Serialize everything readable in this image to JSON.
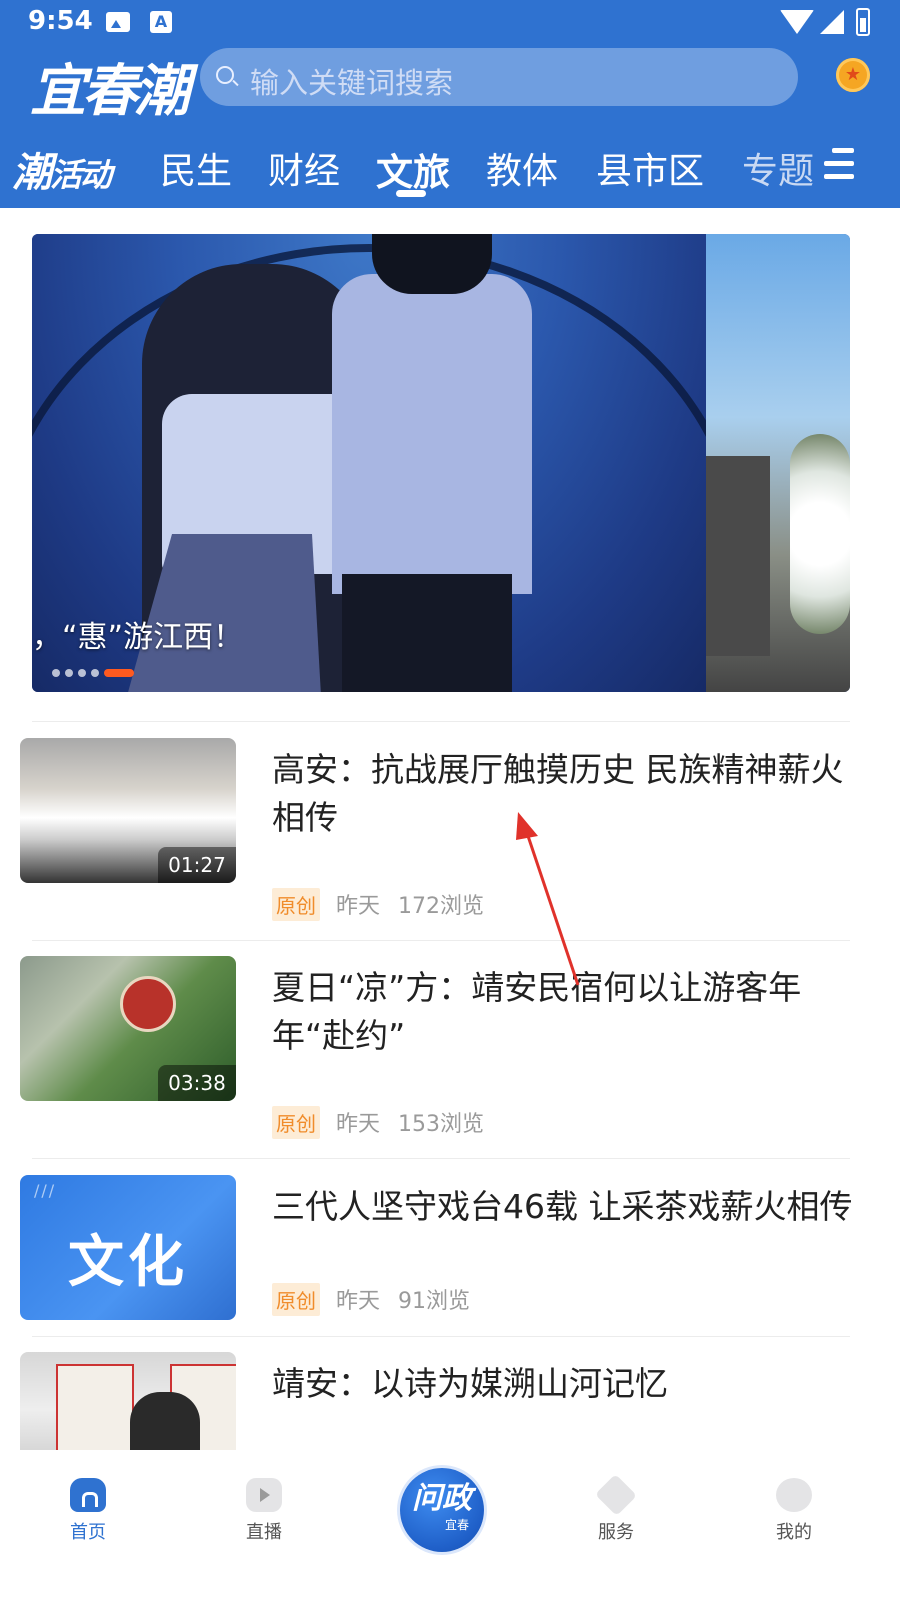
{
  "status_bar": {
    "time": "9:54",
    "notification_letter": "A"
  },
  "header": {
    "logo_text": "宜春潮",
    "search_placeholder": "输入关键词搜索"
  },
  "channel_tabs": {
    "activity_big": "潮",
    "activity_small": "活动",
    "items": [
      "民生",
      "财经",
      "文旅",
      "教体",
      "县市区",
      "专题"
    ],
    "active_index": 2
  },
  "banner": {
    "caption": "，“惠”游江西！",
    "slide_count": 5,
    "active_slide": 4
  },
  "news": [
    {
      "title": "高安：抗战展厅触摸历史 民族精神薪火相传",
      "duration": "01:27",
      "tag": "原创",
      "time": "昨天",
      "views": "172浏览"
    },
    {
      "title": "夏日“凉”方：靖安民宿何以让游客年年“赴约”",
      "duration": "03:38",
      "tag": "原创",
      "time": "昨天",
      "views": "153浏览"
    },
    {
      "title": "三代人坚守戏台46载  让采茶戏薪火相传",
      "thumb_text": "文化",
      "tag": "原创",
      "time": "昨天",
      "views": "91浏览"
    },
    {
      "title": "靖安：以诗为媒溯山河记忆"
    }
  ],
  "bottom_nav": {
    "home": "首页",
    "live": "直播",
    "center_main": "问政",
    "center_sub": "宜春",
    "service": "服务",
    "mine": "我的"
  },
  "colors": {
    "brand_blue": "#2f72d0",
    "tag_orange": "#f08c2b",
    "carousel_active": "#ff5a1f"
  }
}
